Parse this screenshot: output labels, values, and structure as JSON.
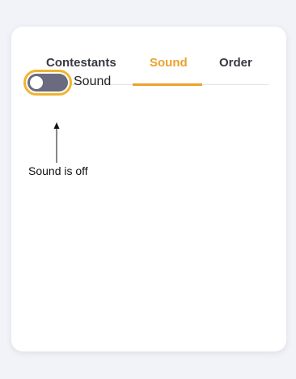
{
  "tabs": [
    {
      "label": "Contestants",
      "active": false
    },
    {
      "label": "Sound",
      "active": true
    },
    {
      "label": "Order",
      "active": false
    }
  ],
  "sound_toggle": {
    "label": "Sound",
    "state": "off"
  },
  "annotation": {
    "caption": "Sound is off"
  },
  "colors": {
    "accent": "#eba22c",
    "toggle_outline": "#f0b52e",
    "toggle_track": "#6a6b7f",
    "page_background": "#f1f3f8",
    "card_background": "#ffffff"
  }
}
